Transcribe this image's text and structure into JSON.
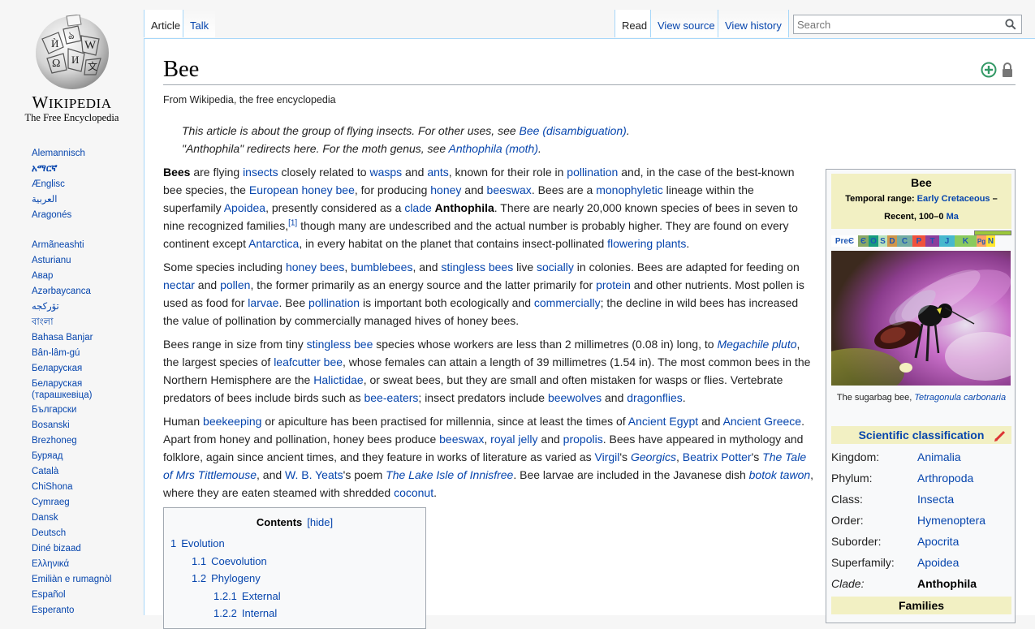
{
  "logo": {
    "wordmark": "Wikipedia",
    "tagline": "The Free Encyclopedia"
  },
  "sidebar": {
    "languages": [
      "Alemannisch",
      "አማርኛ",
      "Ænglisc",
      "العربية",
      "Aragonés",
      "Armãneashti",
      "Asturianu",
      "Авар",
      "Azərbaycanca",
      "تۆرکجه",
      "বাংলা",
      "Bahasa Banjar",
      "Bân-lâm-gú",
      "Беларуская",
      "Беларуская (тарашкевіца)",
      "Български",
      "Bosanski",
      "Brezhoneg",
      "Буряад",
      "Català",
      "ChiShona",
      "Cymraeg",
      "Dansk",
      "Deutsch",
      "Diné bizaad",
      "Ελληνικά",
      "Emiliàn e rumagnòl",
      "Español",
      "Esperanto"
    ]
  },
  "tabs": {
    "article": "Article",
    "talk": "Talk",
    "read": "Read",
    "view_source": "View source",
    "view_history": "View history"
  },
  "search": {
    "placeholder": "Search"
  },
  "page": {
    "title": "Bee",
    "from": "From Wikipedia, the free encyclopedia"
  },
  "hatnotes": {
    "h1_pre": "This article is about the group of flying insects. For other uses, see ",
    "h1_link": "Bee (disambiguation)",
    "h1_post": ".",
    "h2_pre": "\"Anthophila\" redirects here. For the moth genus, see ",
    "h2_link": "Anthophila (moth)",
    "h2_post": "."
  },
  "p1": {
    "line1": [
      [
        "b",
        "Bees"
      ],
      [
        "t",
        " are flying "
      ],
      [
        "a",
        "insects"
      ],
      [
        "t",
        " closely related to "
      ],
      [
        "a",
        "wasps"
      ],
      [
        "t",
        " and "
      ],
      [
        "a",
        "ants"
      ],
      [
        "t",
        ", known for their role in "
      ],
      [
        "a",
        "pollination"
      ],
      [
        "t",
        " and, in the case of the best-known"
      ]
    ],
    "line2": [
      [
        "t",
        "bee species, the "
      ],
      [
        "a",
        "European honey bee"
      ],
      [
        "t",
        ", for producing "
      ],
      [
        "a",
        "honey"
      ],
      [
        "t",
        " and "
      ],
      [
        "a",
        "beeswax"
      ],
      [
        "t",
        ". Bees are a "
      ],
      [
        "a",
        "monophyletic"
      ],
      [
        "t",
        " lineage within the"
      ]
    ],
    "line3": [
      [
        "t",
        "superfamily "
      ],
      [
        "a",
        "Apoidea"
      ],
      [
        "t",
        ", presently considered as a "
      ],
      [
        "a",
        "clade"
      ],
      [
        "t",
        " "
      ],
      [
        "b",
        "Anthophila"
      ],
      [
        "t",
        ". There are nearly 20,000 known species of bees in seven to"
      ]
    ],
    "line4": [
      [
        "t",
        "nine recognized families,"
      ],
      [
        "s",
        "[1]"
      ],
      [
        "t",
        " though many are undescribed and the actual number is probably higher. They are found on every"
      ]
    ],
    "line5": [
      [
        "t",
        "continent except "
      ],
      [
        "a",
        "Antarctica"
      ],
      [
        "t",
        ", in every habitat on the planet that contains insect-pollinated "
      ],
      [
        "a",
        "flowering plants"
      ],
      [
        "t",
        "."
      ]
    ]
  },
  "p2": {
    "line1": [
      [
        "t",
        "Some species including "
      ],
      [
        "a",
        "honey bees"
      ],
      [
        "t",
        ", "
      ],
      [
        "a",
        "bumblebees"
      ],
      [
        "t",
        ", and "
      ],
      [
        "a",
        "stingless bees"
      ],
      [
        "t",
        " live "
      ],
      [
        "a",
        "socially"
      ],
      [
        "t",
        " in colonies. Bees are adapted for feeding on"
      ]
    ],
    "line2": [
      [
        "a",
        "nectar"
      ],
      [
        "t",
        " and "
      ],
      [
        "a",
        "pollen"
      ],
      [
        "t",
        ", the former primarily as an energy source and the latter primarily for "
      ],
      [
        "a",
        "protein"
      ],
      [
        "t",
        " and other nutrients. Most pollen is"
      ]
    ],
    "line3": [
      [
        "t",
        "used as food for "
      ],
      [
        "a",
        "larvae"
      ],
      [
        "t",
        ". Bee "
      ],
      [
        "a",
        "pollination"
      ],
      [
        "t",
        " is important both ecologically and "
      ],
      [
        "a",
        "commercially"
      ],
      [
        "t",
        "; the decline in wild bees has increased"
      ]
    ],
    "line4": [
      [
        "t",
        "the value of pollination by commercially managed hives of honey bees."
      ]
    ]
  },
  "p3": {
    "line1": [
      [
        "t",
        "Bees range in size from tiny "
      ],
      [
        "a",
        "stingless bee"
      ],
      [
        "t",
        " species whose workers are less than 2 millimetres (0.08 in) long, to "
      ],
      [
        "ai",
        "Megachile pluto"
      ],
      [
        "t",
        ","
      ]
    ],
    "line2": [
      [
        "t",
        "the largest species of "
      ],
      [
        "a",
        "leafcutter bee"
      ],
      [
        "t",
        ", whose females can attain a length of 39 millimetres (1.54 in). The most common bees in the"
      ]
    ],
    "line3": [
      [
        "t",
        "Northern Hemisphere are the "
      ],
      [
        "a",
        "Halictidae"
      ],
      [
        "t",
        ", or sweat bees, but they are small and often mistaken for wasps or flies. Vertebrate"
      ]
    ],
    "line4": [
      [
        "t",
        "predators of bees include birds such as "
      ],
      [
        "a",
        "bee-eaters"
      ],
      [
        "t",
        "; insect predators include "
      ],
      [
        "a",
        "beewolves"
      ],
      [
        "t",
        " and "
      ],
      [
        "a",
        "dragonflies"
      ],
      [
        "t",
        "."
      ]
    ]
  },
  "p4": {
    "line1": [
      [
        "t",
        "Human "
      ],
      [
        "a",
        "beekeeping"
      ],
      [
        "t",
        " or apiculture has been practised for millennia, since at least the times of "
      ],
      [
        "a",
        "Ancient Egypt"
      ],
      [
        "t",
        " and "
      ],
      [
        "a",
        "Ancient Greece"
      ],
      [
        "t",
        "."
      ]
    ],
    "line2": [
      [
        "t",
        "Apart from honey and pollination, honey bees produce "
      ],
      [
        "a",
        "beeswax"
      ],
      [
        "t",
        ", "
      ],
      [
        "a",
        "royal jelly"
      ],
      [
        "t",
        " and "
      ],
      [
        "a",
        "propolis"
      ],
      [
        "t",
        ". Bees have appeared in mythology and"
      ]
    ],
    "line3": [
      [
        "t",
        "folklore, again since ancient times, and they feature in works of literature as varied as "
      ],
      [
        "a",
        "Virgil"
      ],
      [
        "t",
        "'s "
      ],
      [
        "ai",
        "Georgics"
      ],
      [
        "t",
        ", "
      ],
      [
        "a",
        "Beatrix Potter"
      ],
      [
        "t",
        "'s "
      ],
      [
        "ai",
        "The Tale"
      ]
    ],
    "line4": [
      [
        "ai",
        "of Mrs Tittlemouse"
      ],
      [
        "t",
        ", and "
      ],
      [
        "a",
        "W. B. Yeats"
      ],
      [
        "t",
        "'s poem "
      ],
      [
        "ai",
        "The Lake Isle of Innisfree"
      ],
      [
        "t",
        ". Bee larvae are included in the Javanese dish "
      ],
      [
        "ai",
        "botok tawon"
      ],
      [
        "t",
        ","
      ]
    ],
    "line5": [
      [
        "t",
        "where they are eaten steamed with shredded "
      ],
      [
        "a",
        "coconut"
      ],
      [
        "t",
        "."
      ]
    ]
  },
  "toc": {
    "title": "Contents",
    "hide": "[hide]",
    "items": [
      {
        "num": "1",
        "label": "Evolution"
      },
      {
        "num": "1.1",
        "label": "Coevolution"
      },
      {
        "num": "1.2",
        "label": "Phylogeny"
      },
      {
        "num": "1.2.1",
        "label": "External"
      },
      {
        "num": "1.2.2",
        "label": "Internal"
      }
    ]
  },
  "infobox": {
    "name": "Bee",
    "temporal_label": "Temporal range:",
    "temporal_link": "Early Cretaceous",
    "temporal_dash": " –",
    "temporal_line2": "Recent, 100–0 ",
    "temporal_ma": "Ma",
    "timescale": [
      "PreЄ",
      "Є",
      "O",
      "S",
      "D",
      "C",
      "P",
      "T",
      "J",
      "K",
      "Pg",
      "N"
    ],
    "caption_pre": "The sugarbag bee, ",
    "caption_link": "Tetragonula carbonaria",
    "sci_heading": "Scientific classification",
    "rows": [
      {
        "k": "Kingdom:",
        "v": "Animalia"
      },
      {
        "k": "Phylum:",
        "v": "Arthropoda"
      },
      {
        "k": "Class:",
        "v": "Insecta"
      },
      {
        "k": "Order:",
        "v": "Hymenoptera"
      },
      {
        "k": "Suborder:",
        "v": "Apocrita"
      },
      {
        "k": "Superfamily:",
        "v": "Apoidea"
      },
      {
        "k": "Clade:",
        "v": "Anthophila"
      }
    ],
    "families": "Families"
  },
  "colors": {
    "link": "#0645ad",
    "infobox_header": "#f2f0c3",
    "tab_border": "#a7d7f9",
    "protect_green": "#339966"
  }
}
